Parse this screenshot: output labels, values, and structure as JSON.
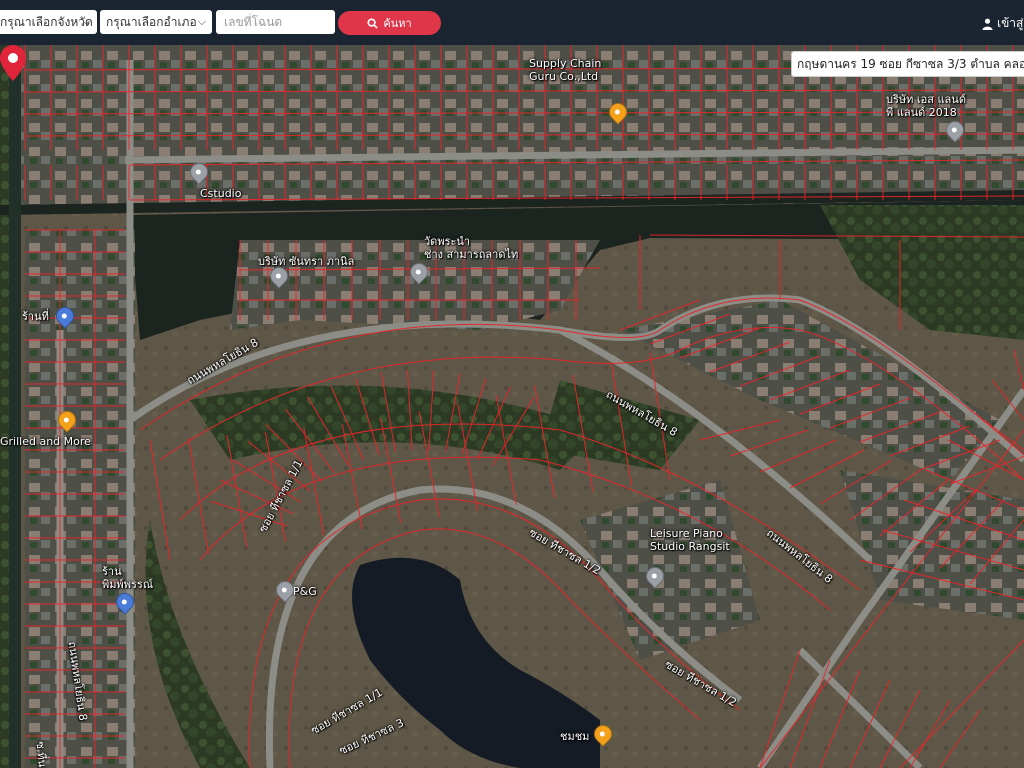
{
  "header": {
    "province_select": "กรุณาเลือกจังหวัด",
    "district_select": "กรุณาเลือกอำเภอ",
    "deed_placeholder": "เลขที่โฉนด",
    "search_label": "ค้นหา",
    "login_label": "เข้าสู่ระ"
  },
  "address": "กฤษดานคร 19 ซอย กีซาซล 3/3 ตำบล คลอ",
  "colors": {
    "topbar": "#1b2431",
    "search_button": "#e0364a",
    "parcel_lines": "#e8252b",
    "marker": "#e0243a"
  },
  "map_labels": [
    {
      "id": "supply",
      "text": "Supply Chain\nGuru Co.,Ltd"
    },
    {
      "id": "company-right",
      "text": "บริษัท เอส แลนด์\nพี แลนด์ 2018"
    },
    {
      "id": "cstudio",
      "text": "Cstudio"
    },
    {
      "id": "company-mid",
      "text": "บริษัท ซันทรา ภานิล"
    },
    {
      "id": "school",
      "text": "วัดพระนำ\nช่าง สามารถลาดไท"
    },
    {
      "id": "left-place",
      "text": "ร้านที่"
    },
    {
      "id": "grilled",
      "text": "Grilled and More"
    },
    {
      "id": "road-1",
      "text": "ถนนพหลโยธิน 8"
    },
    {
      "id": "road-2",
      "text": "ถนนพหลโยธิน 8"
    },
    {
      "id": "road-3",
      "text": "ถนนพหลโยธิน 8"
    },
    {
      "id": "soi-1",
      "text": "ซอย ทีชาซล 1/1"
    },
    {
      "id": "soi-2",
      "text": "ซอย ทีชาซล 1/1"
    },
    {
      "id": "soi-3",
      "text": "ซอย ทีชาซล 1/2"
    },
    {
      "id": "soi-4",
      "text": "ซอย ทีชาซล 1/2"
    },
    {
      "id": "leisure",
      "text": "Leisure Piano\nStudio Rangsit"
    },
    {
      "id": "pg",
      "text": "P&G"
    },
    {
      "id": "local-shop",
      "text": "ร้าน\nพิมพ์พรรณ์"
    },
    {
      "id": "left-road",
      "text": "ถนนพหลโยธิน 8"
    },
    {
      "id": "bottom-left",
      "text": "ซ.ที่นา"
    },
    {
      "id": "soi-bottom",
      "text": "ซอย ทีชาซล 3"
    },
    {
      "id": "shop-bottom",
      "text": "ชมชม"
    }
  ],
  "icons": {
    "search": "search-icon",
    "login": "user-icon",
    "location": "map-marker-icon"
  }
}
